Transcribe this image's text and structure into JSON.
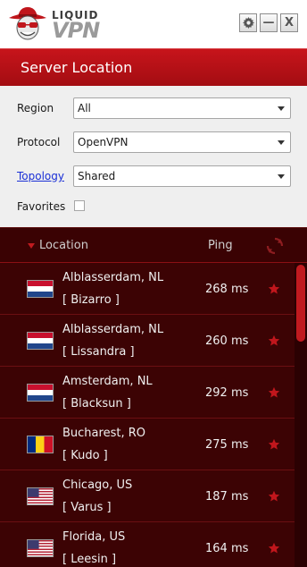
{
  "app": {
    "logo_word_top": "LIQUID",
    "logo_word_bottom": "VPN",
    "brand_color": "#c0161c"
  },
  "window_controls": {
    "settings_icon": "gear-icon",
    "minimize_label": "—",
    "close_label": "X"
  },
  "titlebar": {
    "title": "Server Location"
  },
  "filters": {
    "region": {
      "label": "Region",
      "value": "All"
    },
    "protocol": {
      "label": "Protocol",
      "value": "OpenVPN"
    },
    "topology": {
      "label": "Topology",
      "value": "Shared"
    },
    "favorites": {
      "label": "Favorites",
      "checked": false
    }
  },
  "list": {
    "header": {
      "location": "Location",
      "ping": "Ping",
      "refresh_icon": "refresh-icon"
    },
    "rows": [
      {
        "city": "Alblasserdam, NL",
        "node": "[ Bizarro ]",
        "ping": "268 ms",
        "flag": "NL"
      },
      {
        "city": "Alblasserdam, NL",
        "node": "[ Lissandra ]",
        "ping": "260 ms",
        "flag": "NL"
      },
      {
        "city": "Amsterdam, NL",
        "node": "[ Blacksun ]",
        "ping": "292 ms",
        "flag": "NL"
      },
      {
        "city": "Bucharest, RO",
        "node": "[ Kudo ]",
        "ping": "275 ms",
        "flag": "RO"
      },
      {
        "city": "Chicago, US",
        "node": "[ Varus ]",
        "ping": "187 ms",
        "flag": "US"
      },
      {
        "city": "Florida, US",
        "node": "[ Leesin ]",
        "ping": "164 ms",
        "flag": "US"
      }
    ]
  }
}
